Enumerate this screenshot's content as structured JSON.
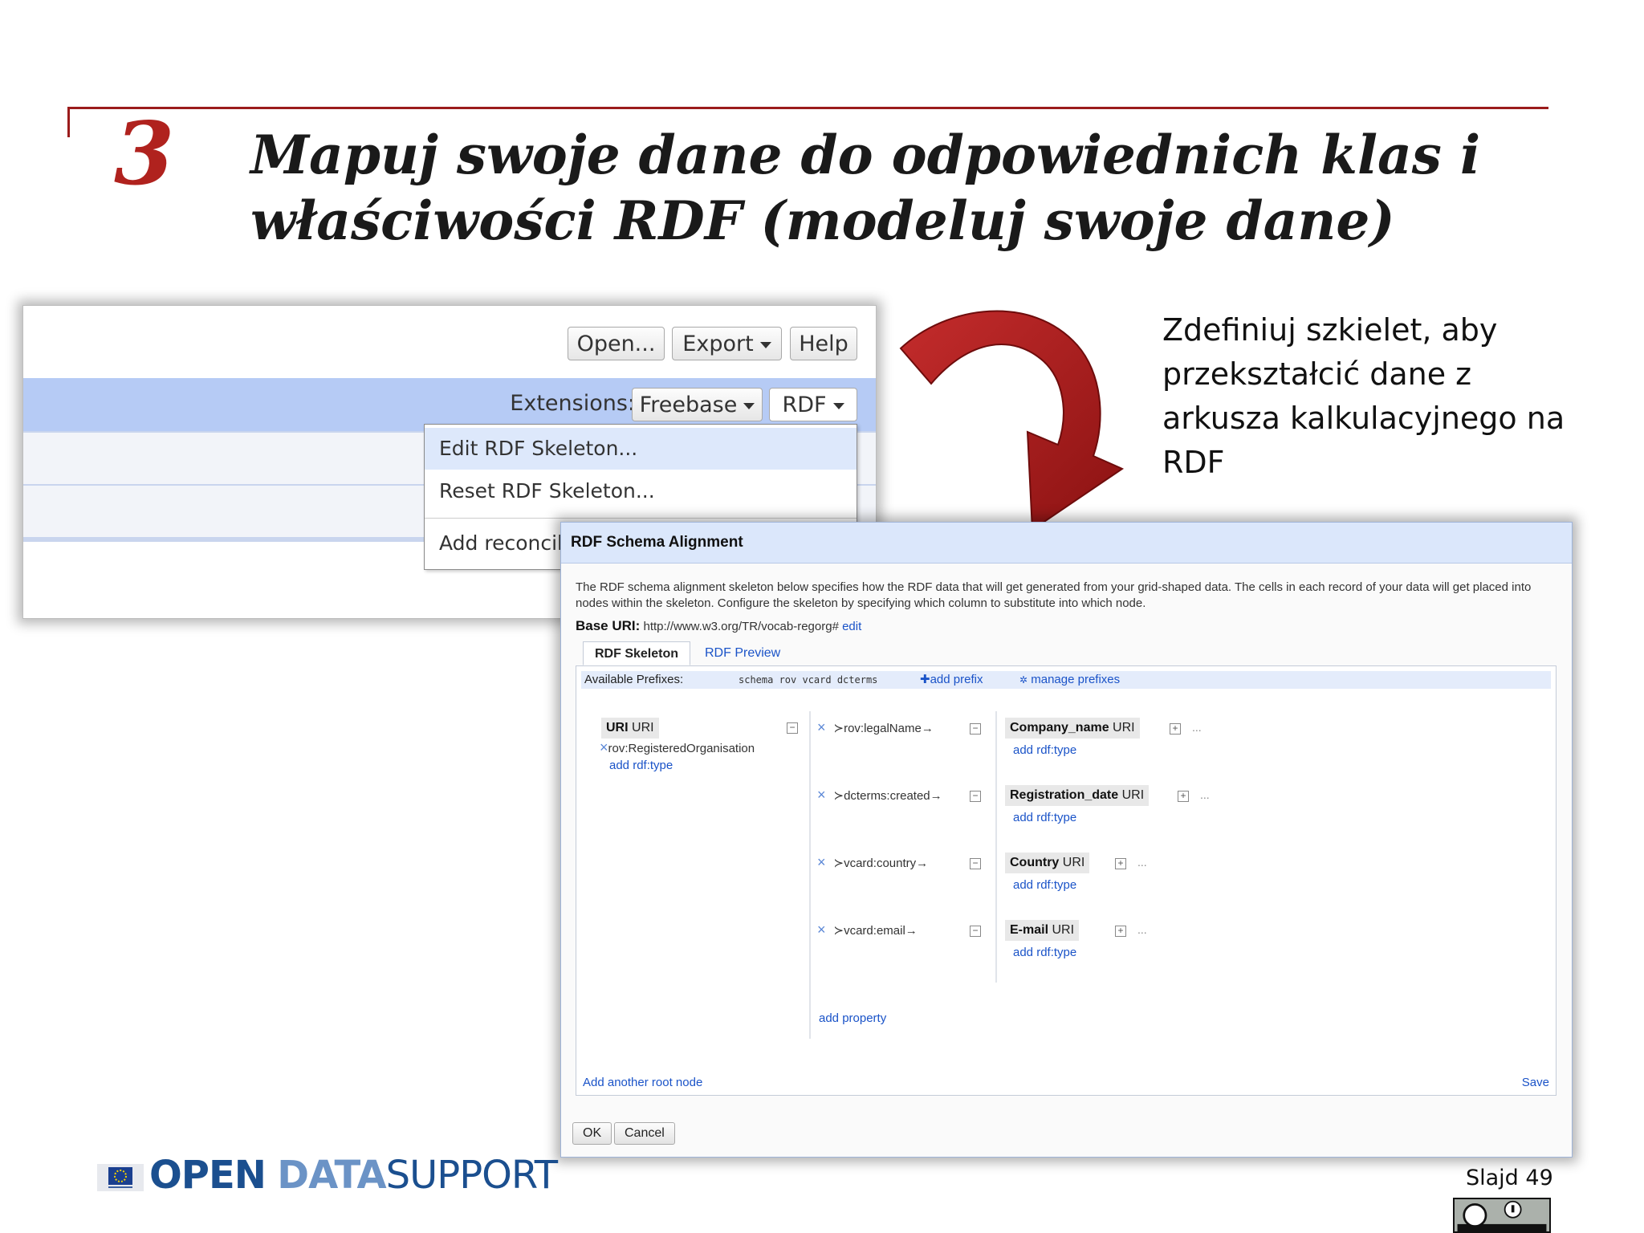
{
  "slide": {
    "step_number": "3",
    "title_line1": "Mapuj swoje dane do odpowiednich klas i",
    "title_line2": "właściwości RDF (modeluj swoje dane)",
    "side_text_lines": [
      "Zdefiniuj szkielet, aby",
      "przekształcić dane z",
      "arkusza kalkulacyjnego na",
      "RDF"
    ],
    "slide_number": "Slajd 49",
    "colors": {
      "accent": "#b0221e",
      "rule": "#9b1c1c",
      "logo_dark": "#1b4f8f",
      "logo_light": "#6b93c6"
    }
  },
  "refine_toolbar": {
    "open_label": "Open...",
    "export_label": "Export",
    "help_label": "Help",
    "extensions_label": "Extensions:",
    "freebase_label": "Freebase",
    "rdf_label": "RDF",
    "menu": {
      "edit_skeleton": "Edit RDF Skeleton...",
      "reset_skeleton": "Reset RDF Skeleton...",
      "add_reconcile": "Add reconcili"
    }
  },
  "dialog": {
    "title": "RDF Schema Alignment",
    "description": "The RDF schema alignment skeleton below specifies how the RDF data that will get generated from your grid-shaped data. The cells in each record of your data will get placed into nodes within the skeleton. Configure the skeleton by specifying which column to substitute into which node.",
    "base_uri_label": "Base URI:",
    "base_uri_value": "http://www.w3.org/TR/vocab-regorg#",
    "edit_link": "edit",
    "tabs": [
      "RDF Skeleton",
      "RDF Preview"
    ],
    "prefixes_label": "Available Prefixes:",
    "prefixes": "schema rov vcard dcterms",
    "add_prefix": "add prefix",
    "manage_prefixes": "manage prefixes",
    "root_node": {
      "name": "URI",
      "suffix": "URI",
      "type": "rov:RegisteredOrganisation",
      "add_type": "add rdf:type"
    },
    "properties": [
      {
        "name": "rov:legalName",
        "target": "Company_name",
        "suffix": "URI",
        "add_type": "add rdf:type"
      },
      {
        "name": "dcterms:created",
        "target": "Registration_date",
        "suffix": "URI",
        "add_type": "add rdf:type"
      },
      {
        "name": "vcard:country",
        "target": "Country",
        "suffix": "URI",
        "add_type": "add rdf:type"
      },
      {
        "name": "vcard:email",
        "target": "E-mail",
        "suffix": "URI",
        "add_type": "add rdf:type"
      }
    ],
    "add_property": "add property",
    "add_root_node": "Add another root node",
    "save": "Save",
    "ok": "OK",
    "cancel": "Cancel"
  },
  "footer_logo": {
    "open": "OPEN",
    "data": "DATA",
    "support": "SUPPORT"
  }
}
